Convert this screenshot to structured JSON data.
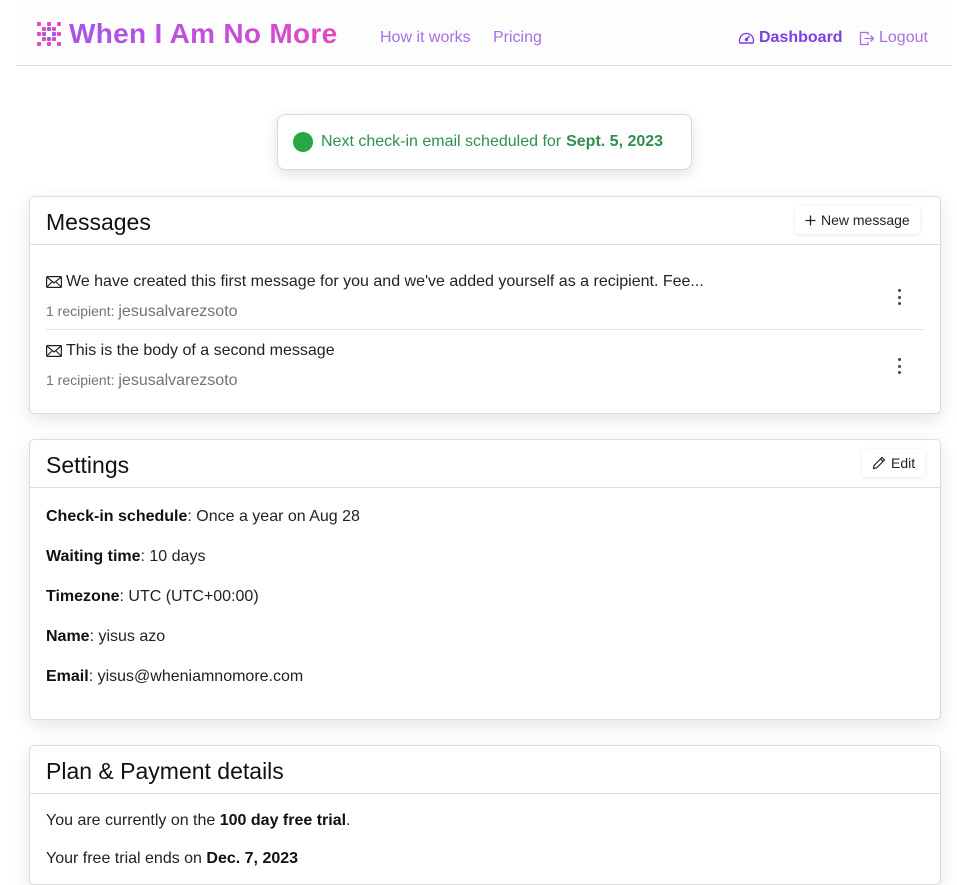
{
  "brand": {
    "name": "When I Am No More",
    "colors": [
      "#a455e6",
      "#e248c4"
    ]
  },
  "nav": {
    "how_it_works": "How it works",
    "pricing": "Pricing",
    "dashboard": "Dashboard",
    "logout": "Logout",
    "link_color": "#a66fe4",
    "active_color": "#7b3fe4"
  },
  "toast": {
    "text": "Next check-in email scheduled for",
    "date": "Sept. 5, 2023",
    "status_color": "#28a745"
  },
  "messages": {
    "title": "Messages",
    "new_button": "New message",
    "items": [
      {
        "text": "We have created this first message for you and we've added yourself as a recipient. Fee...",
        "recipients_label": "1 recipient:",
        "recipient": "jesusalvarezsoto"
      },
      {
        "text": "This is the body of a second message",
        "recipients_label": "1 recipient:",
        "recipient": "jesusalvarezsoto"
      }
    ]
  },
  "settings": {
    "title": "Settings",
    "edit_button": "Edit",
    "rows": [
      {
        "label": "Check-in schedule",
        "value": ": Once a year on Aug 28"
      },
      {
        "label": "Waiting time",
        "value": ": 10 days"
      },
      {
        "label": "Timezone",
        "value": ": UTC (UTC+00:00)"
      },
      {
        "label": "Name",
        "value": ": yisus azo"
      },
      {
        "label": "Email",
        "value": ": yisus@wheniamnomore.com"
      }
    ]
  },
  "plan": {
    "title": "Plan & Payment details",
    "line1_prefix": "You are currently on the",
    "line1_bold": "100 day free trial",
    "line1_suffix": ".",
    "line2_prefix": "Your free trial ends on",
    "line2_bold": "Dec. 7, 2023"
  }
}
